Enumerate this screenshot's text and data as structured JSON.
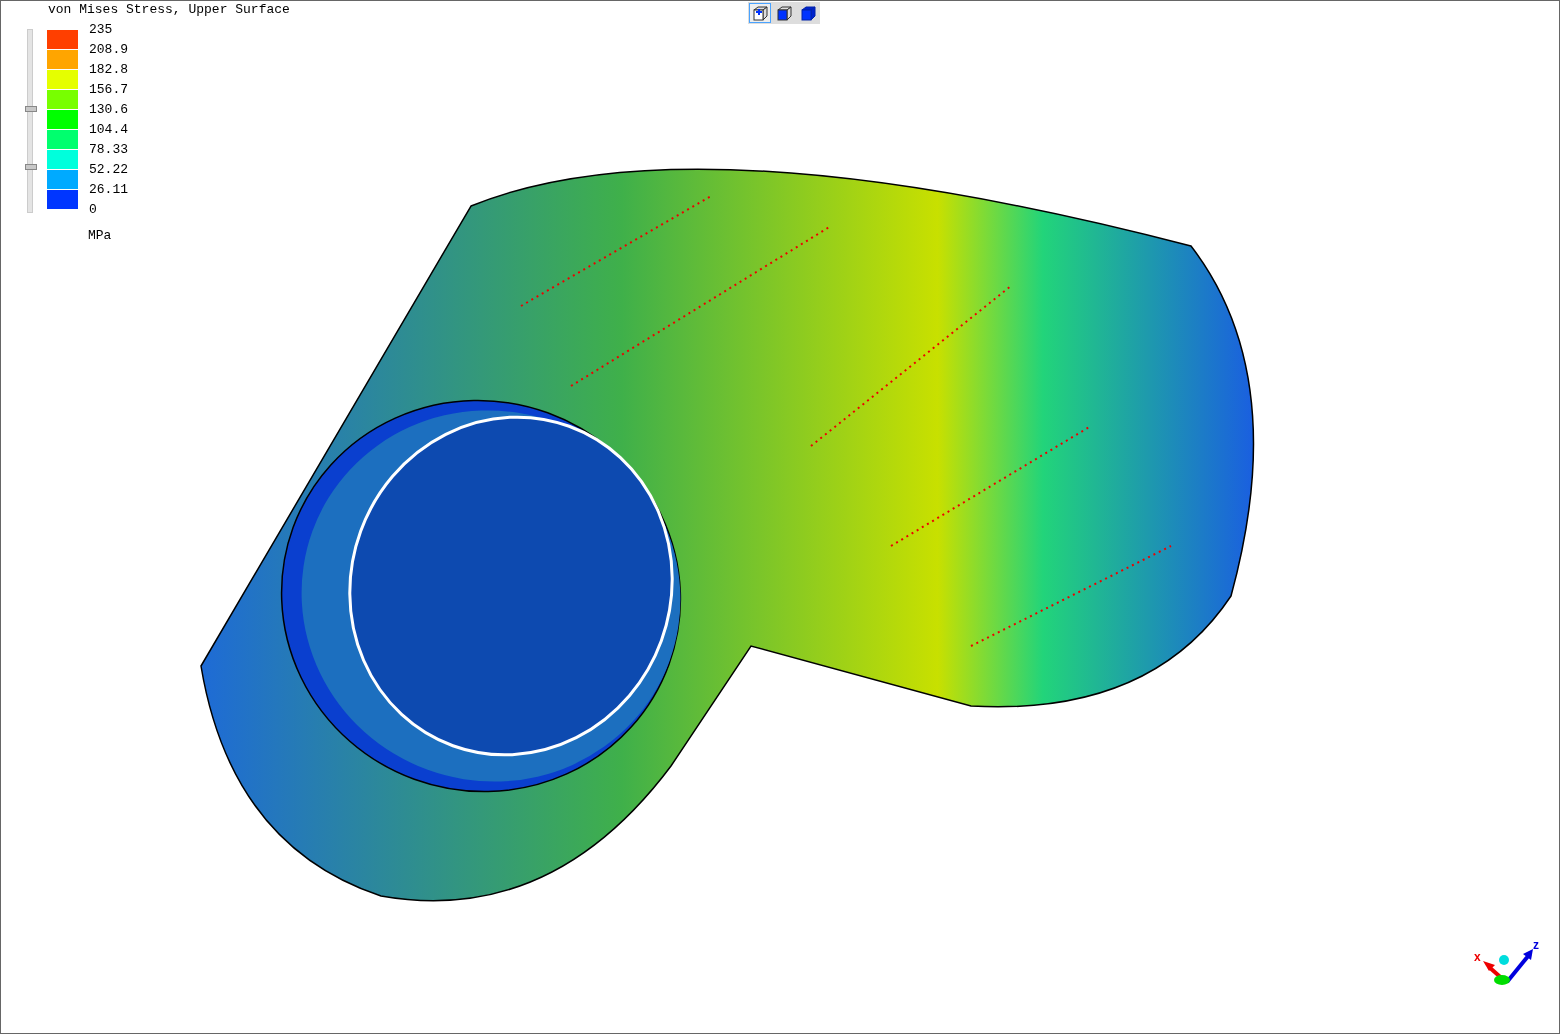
{
  "legend": {
    "title": "von Mises Stress, Upper Surface",
    "bands": [
      {
        "color": "#ff3f00"
      },
      {
        "color": "#ffa500"
      },
      {
        "color": "#e5ff00"
      },
      {
        "color": "#78ff00"
      },
      {
        "color": "#00ff00"
      },
      {
        "color": "#00ff6e"
      },
      {
        "color": "#00ffdc"
      },
      {
        "color": "#00aaff"
      },
      {
        "color": "#0036ff"
      }
    ],
    "labels": [
      "235",
      "208.9",
      "182.8",
      "156.7",
      "130.6",
      "104.4",
      "78.33",
      "52.22",
      "26.11",
      "0"
    ],
    "unit": "MPa",
    "handles": [
      {
        "level": 0.565
      },
      {
        "level": 0.25
      }
    ]
  },
  "toolbar": [
    {
      "kind": "outline",
      "selected": true
    },
    {
      "kind": "shaded",
      "selected": false
    },
    {
      "kind": "solid",
      "selected": false
    }
  ],
  "axes": {
    "x_label": "x",
    "z_label": "z"
  }
}
